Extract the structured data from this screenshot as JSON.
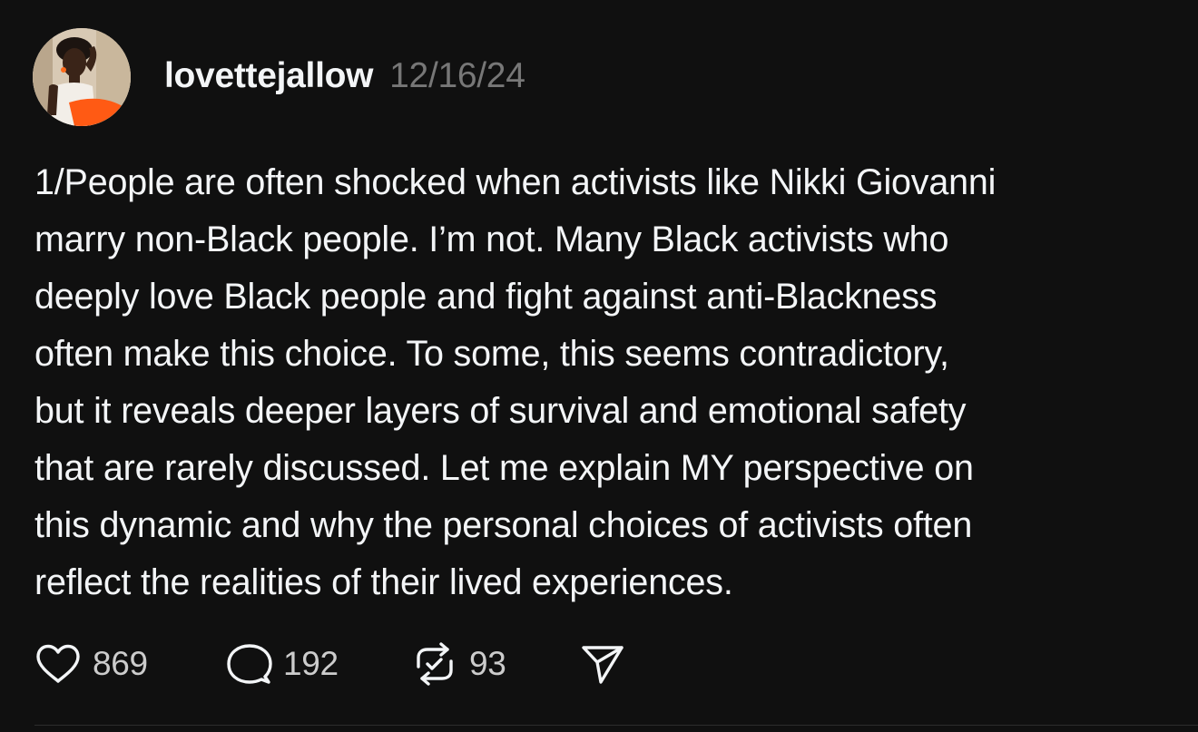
{
  "post": {
    "author": {
      "username": "lovettejallow",
      "timestamp": "12/16/24",
      "avatar_icon": "profile-photo"
    },
    "text_lines": [
      "1/People are often shocked when activists like Nikki Giovanni",
      "marry non-Black people. I’m not. Many Black activists who",
      "deeply love Black people and fight against anti-Blackness",
      "often make this choice. To some, this seems contradictory,",
      "but it reveals deeper layers of survival and emotional safety",
      "that are rarely discussed. Let me explain MY perspective on",
      "this dynamic and why the personal choices of activists often",
      "reflect the realities of their lived experiences."
    ],
    "actions": {
      "like": {
        "icon": "heart-icon",
        "count": "869"
      },
      "reply": {
        "icon": "comment-bubble-icon",
        "count": "192"
      },
      "repost": {
        "icon": "repost-icon",
        "count": "93"
      },
      "share": {
        "icon": "send-icon"
      }
    }
  },
  "colors": {
    "background": "#101010",
    "primary_text": "#f3f5f7",
    "secondary_text": "#777777",
    "counts": "#cccccc"
  }
}
